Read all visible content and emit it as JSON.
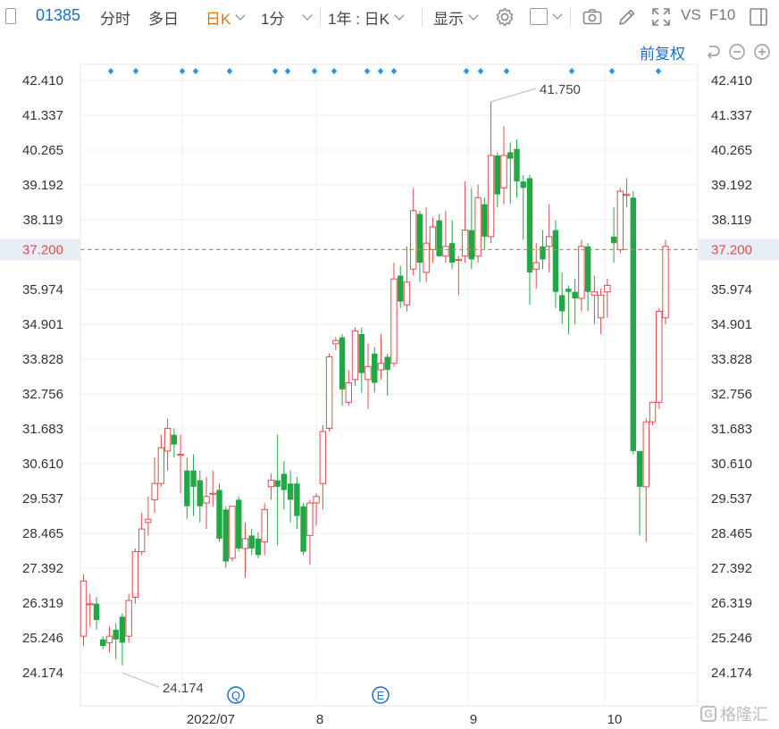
{
  "toolbar": {
    "code": "01385",
    "items": [
      "分时",
      "多日",
      "日K",
      "1分",
      "1年 : 日K",
      "显示"
    ],
    "active": "日K",
    "vs": "VS",
    "f10": "F10",
    "adjust": "前复权"
  },
  "chart_data": {
    "type": "candlestick",
    "ylim": [
      23.5,
      42.9
    ],
    "y_ticks": [
      "42.410",
      "41.337",
      "40.265",
      "39.192",
      "38.119",
      "35.974",
      "34.901",
      "33.828",
      "32.756",
      "31.683",
      "30.610",
      "29.537",
      "28.465",
      "27.392",
      "26.319",
      "25.246",
      "24.174"
    ],
    "current_price": "37.200",
    "x_ticks": [
      "2022/07",
      "8",
      "9",
      "10"
    ],
    "high_label": "41.750",
    "low_label": "24.174",
    "event_markers": [
      "Q",
      "E"
    ],
    "colors": {
      "up": "#e24b4b",
      "down": "#21a744",
      "dividend": "#2196f3",
      "price_line": "#e07b39"
    },
    "candles": [
      {
        "o": 25.3,
        "c": 27.0,
        "h": 27.2,
        "l": 25.0
      },
      {
        "o": 26.3,
        "c": 26.3,
        "h": 26.6,
        "l": 25.6
      },
      {
        "o": 26.3,
        "c": 25.8,
        "h": 26.5,
        "l": 25.5
      },
      {
        "o": 25.2,
        "c": 25.0,
        "h": 25.3,
        "l": 24.9
      },
      {
        "o": 25.1,
        "c": 25.3,
        "h": 25.6,
        "l": 24.8
      },
      {
        "o": 25.5,
        "c": 25.2,
        "h": 25.7,
        "l": 24.6
      },
      {
        "o": 25.9,
        "c": 25.1,
        "h": 26.0,
        "l": 24.4
      },
      {
        "o": 25.3,
        "c": 26.4,
        "h": 26.6,
        "l": 25.1
      },
      {
        "o": 26.5,
        "c": 27.9,
        "h": 28.0,
        "l": 26.3
      },
      {
        "o": 27.9,
        "c": 28.6,
        "h": 29.1,
        "l": 27.8
      },
      {
        "o": 28.8,
        "c": 28.9,
        "h": 29.6,
        "l": 28.4
      },
      {
        "o": 29.5,
        "c": 30.0,
        "h": 30.8,
        "l": 29.1
      },
      {
        "o": 30.0,
        "c": 31.1,
        "h": 31.5,
        "l": 29.9
      },
      {
        "o": 31.0,
        "c": 31.7,
        "h": 32.0,
        "l": 30.4
      },
      {
        "o": 31.5,
        "c": 31.2,
        "h": 31.7,
        "l": 30.8
      },
      {
        "o": 30.9,
        "c": 30.9,
        "h": 31.5,
        "l": 29.7
      },
      {
        "o": 30.4,
        "c": 29.3,
        "h": 30.8,
        "l": 28.9
      },
      {
        "o": 30.4,
        "c": 29.9,
        "h": 30.9,
        "l": 29.0
      },
      {
        "o": 30.1,
        "c": 29.3,
        "h": 30.4,
        "l": 28.8
      },
      {
        "o": 29.4,
        "c": 29.6,
        "h": 30.2,
        "l": 28.6
      },
      {
        "o": 29.7,
        "c": 29.7,
        "h": 30.4,
        "l": 29.3
      },
      {
        "o": 29.8,
        "c": 28.3,
        "h": 30.0,
        "l": 28.2
      },
      {
        "o": 29.2,
        "c": 27.6,
        "h": 29.3,
        "l": 27.4
      },
      {
        "o": 27.7,
        "c": 29.3,
        "h": 29.3,
        "l": 27.6
      },
      {
        "o": 29.5,
        "c": 28.0,
        "h": 29.6,
        "l": 27.9
      },
      {
        "o": 28.0,
        "c": 28.3,
        "h": 28.8,
        "l": 27.1
      },
      {
        "o": 28.4,
        "c": 28.0,
        "h": 28.6,
        "l": 27.8
      },
      {
        "o": 28.3,
        "c": 27.8,
        "h": 28.5,
        "l": 27.7
      },
      {
        "o": 28.2,
        "c": 29.2,
        "h": 29.4,
        "l": 27.8
      },
      {
        "o": 29.9,
        "c": 30.1,
        "h": 30.3,
        "l": 29.5
      },
      {
        "o": 30.1,
        "c": 29.9,
        "h": 31.5,
        "l": 28.1
      },
      {
        "o": 30.3,
        "c": 29.8,
        "h": 30.7,
        "l": 29.2
      },
      {
        "o": 30.0,
        "c": 29.5,
        "h": 30.4,
        "l": 28.8
      },
      {
        "o": 30.0,
        "c": 29.0,
        "h": 30.2,
        "l": 28.6
      },
      {
        "o": 29.3,
        "c": 27.9,
        "h": 29.4,
        "l": 27.8
      },
      {
        "o": 28.4,
        "c": 29.4,
        "h": 29.5,
        "l": 27.5
      },
      {
        "o": 29.4,
        "c": 29.6,
        "h": 29.7,
        "l": 28.7
      },
      {
        "o": 30.0,
        "c": 31.6,
        "h": 31.8,
        "l": 29.2
      },
      {
        "o": 31.7,
        "c": 33.9,
        "h": 34.0,
        "l": 31.6
      },
      {
        "o": 34.3,
        "c": 34.4,
        "h": 34.5,
        "l": 34.1
      },
      {
        "o": 34.5,
        "c": 32.9,
        "h": 34.6,
        "l": 32.4
      },
      {
        "o": 32.5,
        "c": 33.1,
        "h": 33.5,
        "l": 32.4
      },
      {
        "o": 33.2,
        "c": 34.7,
        "h": 34.8,
        "l": 33.0
      },
      {
        "o": 34.6,
        "c": 33.4,
        "h": 34.8,
        "l": 32.8
      },
      {
        "o": 33.2,
        "c": 33.6,
        "h": 34.3,
        "l": 32.3
      },
      {
        "o": 34.0,
        "c": 33.1,
        "h": 34.2,
        "l": 32.8
      },
      {
        "o": 33.5,
        "c": 33.7,
        "h": 34.6,
        "l": 33.2
      },
      {
        "o": 33.9,
        "c": 33.5,
        "h": 34.0,
        "l": 32.7
      },
      {
        "o": 33.7,
        "c": 36.3,
        "h": 36.8,
        "l": 33.6
      },
      {
        "o": 36.4,
        "c": 35.6,
        "h": 36.7,
        "l": 35.4
      },
      {
        "o": 35.5,
        "c": 36.2,
        "h": 37.3,
        "l": 35.3
      },
      {
        "o": 36.6,
        "c": 38.4,
        "h": 39.1,
        "l": 36.4
      },
      {
        "o": 38.3,
        "c": 36.8,
        "h": 38.4,
        "l": 36.2
      },
      {
        "o": 36.5,
        "c": 37.4,
        "h": 38.5,
        "l": 36.2
      },
      {
        "o": 37.2,
        "c": 37.9,
        "h": 38.2,
        "l": 36.8
      },
      {
        "o": 38.1,
        "c": 37.0,
        "h": 38.3,
        "l": 37.0
      },
      {
        "o": 37.0,
        "c": 37.3,
        "h": 38.4,
        "l": 36.8
      },
      {
        "o": 37.4,
        "c": 36.8,
        "h": 38.1,
        "l": 36.6
      },
      {
        "o": 36.9,
        "c": 36.9,
        "h": 37.0,
        "l": 35.8
      },
      {
        "o": 37.0,
        "c": 37.8,
        "h": 39.3,
        "l": 36.8
      },
      {
        "o": 37.8,
        "c": 36.9,
        "h": 39.1,
        "l": 36.6
      },
      {
        "o": 37.0,
        "c": 38.8,
        "h": 39.2,
        "l": 36.8
      },
      {
        "o": 38.6,
        "c": 37.6,
        "h": 38.8,
        "l": 37.2
      },
      {
        "o": 37.6,
        "c": 40.1,
        "h": 41.75,
        "l": 37.4
      },
      {
        "o": 40.1,
        "c": 38.9,
        "h": 40.2,
        "l": 38.5
      },
      {
        "o": 39.1,
        "c": 40.1,
        "h": 41.0,
        "l": 38.6
      },
      {
        "o": 40.2,
        "c": 40.0,
        "h": 40.5,
        "l": 38.6
      },
      {
        "o": 40.3,
        "c": 39.3,
        "h": 40.6,
        "l": 38.8
      },
      {
        "o": 39.3,
        "c": 39.1,
        "h": 39.5,
        "l": 37.5
      },
      {
        "o": 39.4,
        "c": 36.5,
        "h": 39.5,
        "l": 35.5
      },
      {
        "o": 36.6,
        "c": 36.8,
        "h": 37.4,
        "l": 36.0
      },
      {
        "o": 37.3,
        "c": 36.9,
        "h": 37.8,
        "l": 36.6
      },
      {
        "o": 37.3,
        "c": 37.6,
        "h": 38.6,
        "l": 36.5
      },
      {
        "o": 37.8,
        "c": 35.9,
        "h": 38.1,
        "l": 35.4
      },
      {
        "o": 35.8,
        "c": 35.3,
        "h": 36.5,
        "l": 34.9
      },
      {
        "o": 36.0,
        "c": 35.9,
        "h": 36.1,
        "l": 34.6
      },
      {
        "o": 35.9,
        "c": 35.7,
        "h": 36.3,
        "l": 34.9
      },
      {
        "o": 35.7,
        "c": 37.3,
        "h": 37.5,
        "l": 35.3
      },
      {
        "o": 37.3,
        "c": 35.9,
        "h": 37.4,
        "l": 35.3
      },
      {
        "o": 35.8,
        "c": 35.9,
        "h": 36.4,
        "l": 34.9
      },
      {
        "o": 35.1,
        "c": 35.8,
        "h": 36.0,
        "l": 34.6
      },
      {
        "o": 35.9,
        "c": 36.1,
        "h": 36.3,
        "l": 35.1
      },
      {
        "o": 37.6,
        "c": 37.4,
        "h": 38.5,
        "l": 36.8
      },
      {
        "o": 37.2,
        "c": 39.0,
        "h": 39.1,
        "l": 37.1
      },
      {
        "o": 38.9,
        "c": 38.9,
        "h": 39.4,
        "l": 38.5
      },
      {
        "o": 38.8,
        "c": 31.0,
        "h": 39.0,
        "l": 30.9
      },
      {
        "o": 31.0,
        "c": 29.9,
        "h": 31.0,
        "l": 28.4
      },
      {
        "o": 29.9,
        "c": 31.9,
        "h": 32.0,
        "l": 28.2
      },
      {
        "o": 31.9,
        "c": 32.5,
        "h": 32.5,
        "l": 31.8
      },
      {
        "o": 32.5,
        "c": 35.3,
        "h": 35.4,
        "l": 32.3
      },
      {
        "o": 35.1,
        "c": 37.3,
        "h": 37.5,
        "l": 34.9
      }
    ]
  }
}
